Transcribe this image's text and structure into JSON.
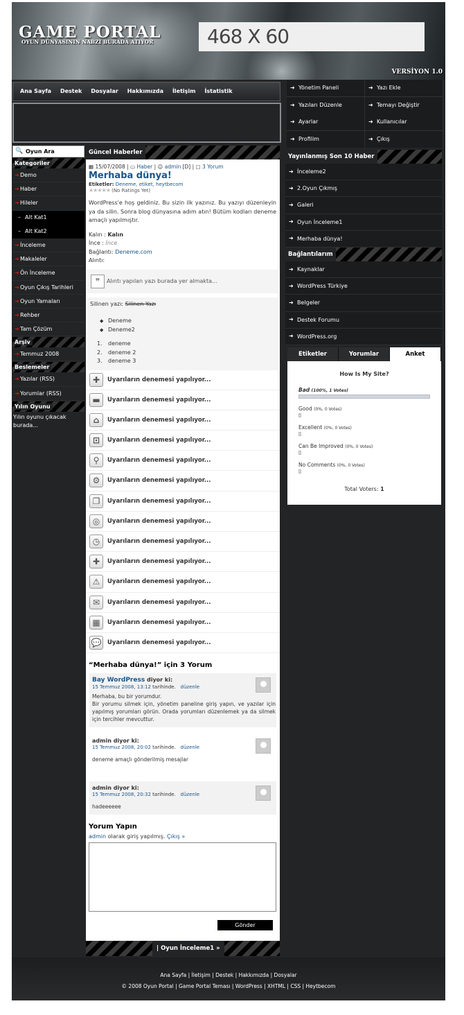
{
  "header": {
    "logo": "GAME PORTAL",
    "slogan": "OYUN DÜNYASININ NABZI BURADA ATIYOR",
    "ad": "468 X 60",
    "version": "VERSİYON 1.0"
  },
  "nav": [
    "Ana Sayfa",
    "Destek",
    "Dosyalar",
    "Hakkımızda",
    "İletişim",
    "İstatistik"
  ],
  "admin_menu": [
    [
      "Yönetim Paneli",
      "Yazı Ekle"
    ],
    [
      "Yazıları Düzenle",
      "Temayı Değiştir"
    ],
    [
      "Ayarlar",
      "Kullanıcılar"
    ],
    [
      "Profilim",
      "Çıkış"
    ]
  ],
  "left": {
    "search": "Oyun Ara",
    "categories_title": "Kategoriler",
    "categories": [
      "Demo",
      "Haber",
      "Hileler"
    ],
    "subs": [
      "Alt Kat1",
      "Alt Kat2"
    ],
    "categories2": [
      "İnceleme",
      "Makaleler",
      "Ön İnceleme",
      "Oyun Çıkış Tarihleri",
      "Oyun Yamaları",
      "Rehber",
      "Tam Çözüm"
    ],
    "archive_title": "Arşiv",
    "archive": [
      "Temmuz 2008"
    ],
    "feeds_title": "Beslemeler",
    "feeds": [
      "Yazılar (RSS)",
      "Yorumlar (RSS)"
    ],
    "goty_title": "Yılın Oyunu",
    "goty_text": "Yılın oyunu çıkacak burada..."
  },
  "main": {
    "section": "Güncel Haberler",
    "meta": {
      "date": "15/07/2008",
      "cat": "Haber",
      "author": "admin",
      "author_tag": "[D]",
      "comments": "3 Yorum"
    },
    "title": "Merhaba dünya!",
    "tags_label": "Etiketler:",
    "tags": "Deneme, etiket, heytbecom",
    "ratings": "(No Ratings Yet)",
    "intro": "WordPress'e hoş geldiniz. Bu sizin ilk yazınız. Bu yazıyı düzenleyin ya da silin. Sonra blog dünyasına adım atın! Bütüm kodları deneme amaçlı yapılmıştır.",
    "bold_label": "Kalın :",
    "bold_val": "Kalın",
    "italic_label": "İnce :",
    "italic_val": "İnce",
    "link_label": "Bağlantı:",
    "link_val": "Deneme.com",
    "quote_label": "Alıntı:",
    "quote": "Alıntı yapılan yazı burada yer almakta...",
    "deleted_label": "Silinen yazı:",
    "deleted_val": "Silinen Yazı",
    "ul": [
      "Deneme",
      "Deneme2"
    ],
    "ol": [
      "1.",
      "2.",
      "3."
    ],
    "ol_text": [
      "deneme",
      "deneme 2",
      "deneme 3"
    ],
    "warnings": [
      "Uyarıların denemesi yapılıyor...",
      "Uyarıların denemesi yapılıyor...",
      "Uyarıların denemesi yapılıyor...",
      "Uyarıların denemesi yapılıyor...",
      "Uyarıların denemesi yapılıyor...",
      "Uyarıların denemesi yapılıyor...",
      "Uyarıların denemesi yapılıyor...",
      "Uyarıların denemesi yapılıyor...",
      "Uyarıların denemesi yapılıyor...",
      "Uyarıların denemesi yapılıyor...",
      "Uyarıların denemesi yapılıyor...",
      "Uyarıların denemesi yapılıyor...",
      "Uyarıların denemesi yapılıyor...",
      "Uyarıların denemesi yapılıyor..."
    ],
    "comments_title": "“Merhaba dünya!” için 3 Yorum",
    "comments": [
      {
        "name": "Bay WordPress",
        "says": "diyor ki:",
        "date": "15 Temmuz 2008, 13:12",
        "date_suffix": "tarihinde.",
        "edit": "düzenle",
        "text": "Merhaba, bu bir yorumdur.\nBir yorumu silmek için, yönetim paneline giriş yapın, ve yazılar için yapılmış yorumları görün. Orada yorumları düzenlemek ya da silmek için tercihler mevcuttur."
      },
      {
        "name": "admin",
        "says": "diyor ki:",
        "date": "15 Temmuz 2008, 20:02",
        "date_suffix": "tarihinde.",
        "edit": "düzenle",
        "text": "deneme amaçlı gönderilmiş mesajlar"
      },
      {
        "name": "admin",
        "says": "diyor ki:",
        "date": "15 Temmuz 2008, 20:32",
        "date_suffix": "tarihinde.",
        "edit": "düzenle",
        "text": "hadeeeeee"
      }
    ],
    "reply_title": "Yorum Yapın",
    "logged_user": "admin",
    "logged_text": "olarak giriş yapılmış.",
    "logout": "Çıkış »",
    "submit": "Gönder",
    "bottom_link": "| Oyun İnceleme1 »"
  },
  "right": {
    "latest_title": "Yayınlanmış Son 10 Haber",
    "latest": [
      "İnceleme2",
      "2.Oyun Çıkmış",
      "Galeri",
      "Oyun İnceleme1",
      "Merhaba dünya!"
    ],
    "links_title": "Bağlantılarım",
    "links": [
      "Kaynaklar",
      "WordPress Türkiye",
      "Belgeler",
      "Destek Forumu",
      "WordPress.org"
    ],
    "tabs": [
      "Etiketler",
      "Yorumlar",
      "Anket"
    ],
    "poll": {
      "question": "How Is My Site?",
      "options": [
        {
          "label": "Bad",
          "info": "(100%, 1 Votes)",
          "pct": 100
        },
        {
          "label": "Good",
          "info": "(0%, 0 Votes)",
          "pct": 0
        },
        {
          "label": "Excellent",
          "info": "(0%, 0 Votes)",
          "pct": 0
        },
        {
          "label": "Can Be Improved",
          "info": "(0%, 0 Votes)",
          "pct": 0
        },
        {
          "label": "No Comments",
          "info": "(0%, 0 Votes)",
          "pct": 0
        }
      ],
      "total_label": "Total Voters:",
      "total": "1"
    }
  },
  "footer": {
    "links": "Ana Sayfa | İletişim | Destek | Hakkımızda | Dosyalar",
    "copy": "© 2008 Oyun Portal | Game Portal Teması | WordPress | XHTML | CSS | Heytbecom"
  },
  "colors": {
    "accent": "#19558b",
    "bg": "#232425",
    "arrow": "#dd1111"
  }
}
